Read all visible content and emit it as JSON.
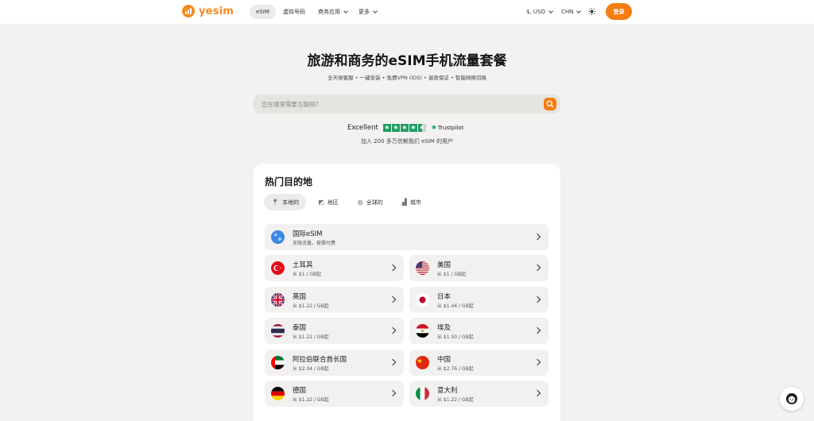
{
  "header": {
    "logo_text": "yesim",
    "nav": [
      {
        "label": "eSIM",
        "active": true
      },
      {
        "label": "虚拟号码",
        "active": false
      },
      {
        "label": "商务应用",
        "active": false
      },
      {
        "label": "更多",
        "active": false
      }
    ],
    "currency": "$, USD",
    "language": "CHN",
    "theme_icon": "sun-icon",
    "login_label": "登录"
  },
  "hero": {
    "title": "旅游和商务的eSIM手机流量套餐",
    "subtitle": "全天候客服 • 一键安装 • 免费VPN (iOS) • 退款保证 • 智能网络切换",
    "search_placeholder": "您在哪里需要互联网?",
    "trust_label": "Excellent",
    "trust_brand": "Trustpilot",
    "users_text": "加入 200 多万信赖我们 eSIM 的用户"
  },
  "popular": {
    "title": "热门目的地",
    "tabs": [
      {
        "label": "本地的",
        "icon": "pin-icon",
        "active": true
      },
      {
        "label": "地区",
        "icon": "map-icon",
        "active": false
      },
      {
        "label": "全球的",
        "icon": "globe-icon",
        "active": false
      },
      {
        "label": "城市",
        "icon": "city-icon",
        "active": false
      }
    ],
    "global": {
      "name": "国际eSIM",
      "sub": "无限流量。按需付费",
      "icon": "globe-icon"
    },
    "destinations": [
      {
        "name": "土耳其",
        "price": "从 $1 / GB起",
        "flag": "turkey"
      },
      {
        "name": "美国",
        "price": "从 $1 / GB起",
        "flag": "usa"
      },
      {
        "name": "英国",
        "price": "从 $1.22 / GB起",
        "flag": "uk"
      },
      {
        "name": "日本",
        "price": "从 $1.44 / GB起",
        "flag": "japan"
      },
      {
        "name": "泰国",
        "price": "从 $1.22 / GB起",
        "flag": "thailand"
      },
      {
        "name": "埃及",
        "price": "从 $1.50 / GB起",
        "flag": "egypt"
      },
      {
        "name": "阿拉伯联合酋长国",
        "price": "从 $2.04 / GB起",
        "flag": "uae"
      },
      {
        "name": "中国",
        "price": "从 $2.76 / GB起",
        "flag": "china"
      },
      {
        "name": "德国",
        "price": "从 $1.22 / GB起",
        "flag": "germany"
      },
      {
        "name": "意大利",
        "price": "从 $1.22 / GB起",
        "flag": "italy"
      }
    ]
  },
  "colors": {
    "accent": "#f57c0f",
    "background": "#f3f2f0",
    "trustpilot": "#1e9d63"
  }
}
